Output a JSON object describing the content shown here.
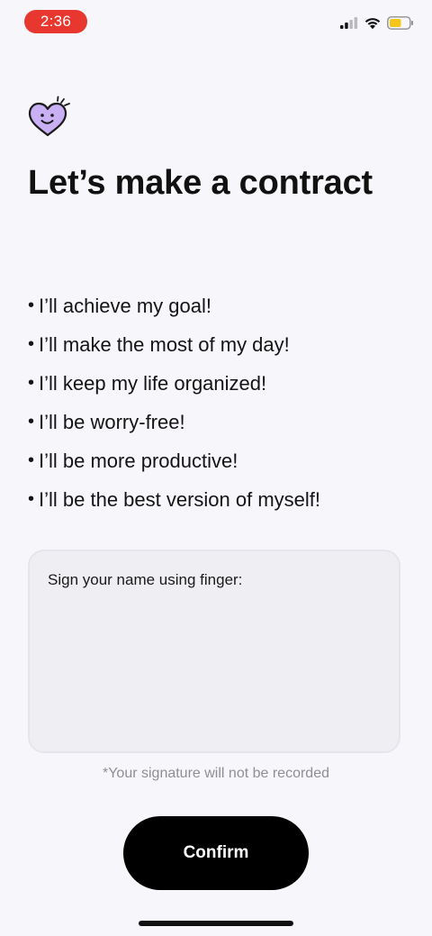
{
  "status_bar": {
    "time": "2:36",
    "time_pill_color": "#e8372f",
    "battery_color": "#f5c518",
    "icons": [
      "signal-icon",
      "wifi-icon",
      "battery-icon"
    ]
  },
  "header": {
    "icon": "heart-face-icon",
    "icon_color": "#c9b0f5",
    "title": "Let’s make a contract"
  },
  "promises": [
    "I’ll achieve my goal!",
    "I’ll make the most of my day!",
    "I’ll keep my life organized!",
    "I’ll be worry-free!",
    "I’ll be more productive!",
    "I’ll be the best version of myself!"
  ],
  "signature": {
    "prompt": "Sign your name using finger:",
    "note": "*Your signature will not be recorded"
  },
  "actions": {
    "confirm_label": "Confirm"
  }
}
